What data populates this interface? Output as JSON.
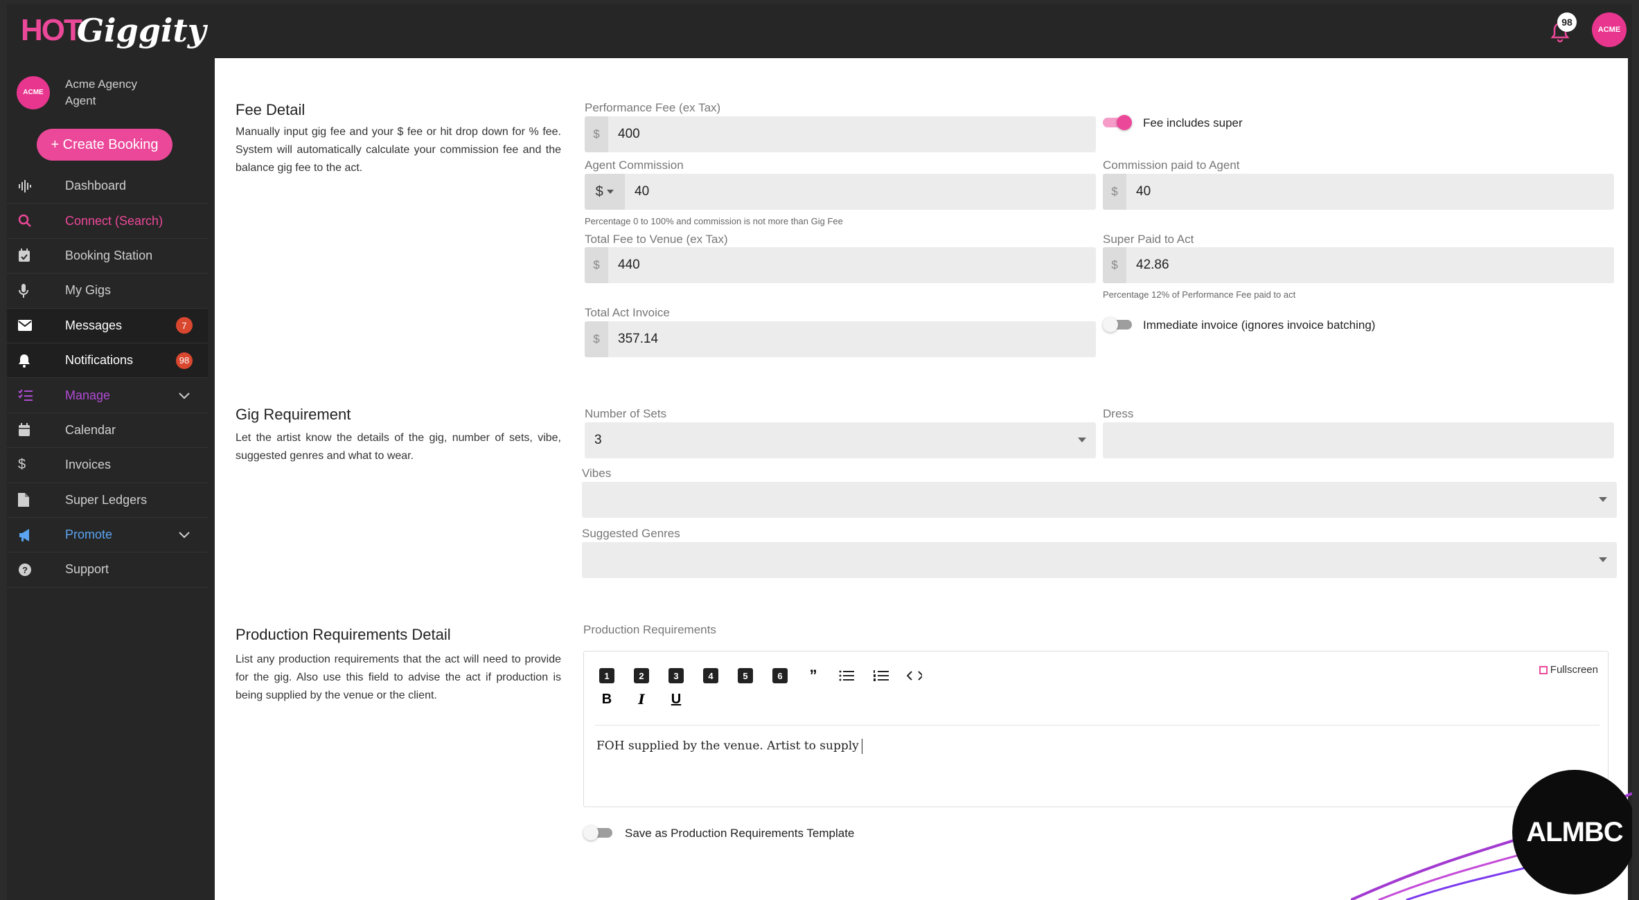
{
  "brand": {
    "logo_hot": "HOT",
    "logo_giggity": "Giggity",
    "accent": "#ec4899"
  },
  "header": {
    "notification_count": "98",
    "avatar_text": "ACME"
  },
  "sidebar": {
    "agency_name": "Acme Agency",
    "agency_role": "Agent",
    "avatar_text": "ACME",
    "create_booking": "+ Create Booking",
    "items": [
      {
        "label": "Dashboard",
        "icon": "waveform-icon"
      },
      {
        "label": "Connect (Search)",
        "icon": "search-icon"
      },
      {
        "label": "Booking Station",
        "icon": "calendar-check-icon"
      },
      {
        "label": "My Gigs",
        "icon": "microphone-icon"
      },
      {
        "label": "Messages",
        "icon": "envelope-icon",
        "badge": "7"
      },
      {
        "label": "Notifications",
        "icon": "bell-icon",
        "badge": "98"
      },
      {
        "label": "Manage",
        "icon": "list-check-icon"
      },
      {
        "label": "Calendar",
        "icon": "calendar-icon"
      },
      {
        "label": "Invoices",
        "icon": "dollar-icon"
      },
      {
        "label": "Super Ledgers",
        "icon": "file-icon"
      },
      {
        "label": "Promote",
        "icon": "megaphone-icon"
      },
      {
        "label": "Support",
        "icon": "question-icon"
      }
    ]
  },
  "fee": {
    "title": "Fee Detail",
    "desc": "Manually input gig fee and your $ fee or hit drop down for % fee. System will automatically calculate your commission fee and the balance gig fee to the act.",
    "performance_fee_label": "Performance Fee (ex Tax)",
    "performance_fee": "400",
    "fee_includes_super": "Fee includes super",
    "agent_commission_label": "Agent Commission",
    "agent_commission_type": "$",
    "agent_commission": "40",
    "commission_hint": "Percentage 0 to 100% and commission is not more than Gig Fee",
    "commission_paid_label": "Commission paid to Agent",
    "commission_paid": "40",
    "total_fee_label": "Total Fee to Venue (ex Tax)",
    "total_fee": "440",
    "super_paid_label": "Super Paid to Act",
    "super_paid": "42.86",
    "super_hint": "Percentage 12% of Performance Fee paid to act",
    "total_act_label": "Total Act Invoice",
    "total_act": "357.14",
    "immediate_invoice": "Immediate invoice (ignores invoice batching)",
    "currency": "$"
  },
  "gig": {
    "title": "Gig Requirement",
    "desc": "Let the artist know the details of the gig, number of sets, vibe, suggested genres and what to wear.",
    "sets_label": "Number of Sets",
    "sets": "3",
    "dress_label": "Dress",
    "dress": "",
    "vibes_label": "Vibes",
    "genres_label": "Suggested Genres"
  },
  "production": {
    "title": "Production Requirements Detail",
    "desc": "List any production requirements that the act will need to provide for the gig. Also use this field to advise the act if production is being supplied by the venue or the client.",
    "editor_label": "Production Requirements",
    "fullscreen": "Fullscreen",
    "content": "FOH supplied by the venue. Artist to supply",
    "save_template": "Save as Production Requirements Template",
    "toolbar": [
      "1",
      "2",
      "3",
      "4",
      "5",
      "6",
      "”",
      "B",
      "I",
      "U"
    ]
  },
  "watermark": "ALMBC"
}
